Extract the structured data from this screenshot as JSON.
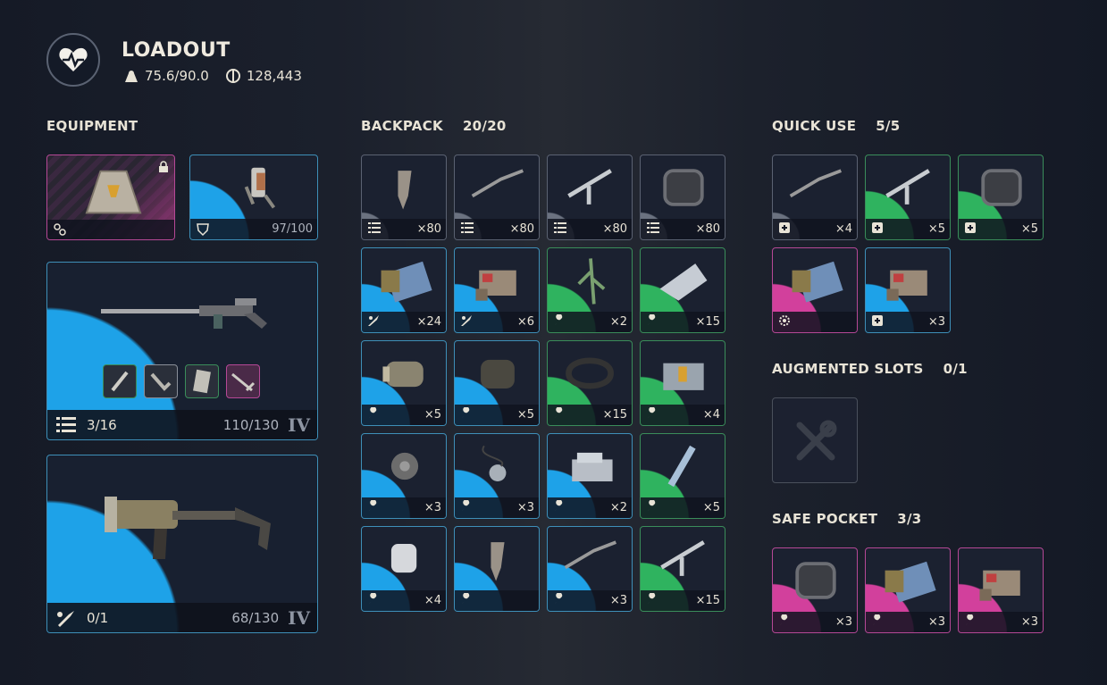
{
  "header": {
    "title": "LOADOUT",
    "weight": "75.6/90.0",
    "currency": "128,443"
  },
  "equipment": {
    "label": "EQUIPMENT",
    "augment": {
      "name": "augment-slot"
    },
    "shield": {
      "durability": "97/100"
    },
    "weapon1": {
      "ammo": "3/16",
      "durability": "110/130",
      "tier": "IV"
    },
    "weapon2": {
      "ammo": "0/1",
      "durability": "68/130",
      "tier": "IV"
    }
  },
  "backpack": {
    "label": "BACKPACK",
    "count": "20/20",
    "items": [
      {
        "icon": "ammo-icon",
        "qty": "×80",
        "rarity": "gray"
      },
      {
        "icon": "ammo-icon",
        "qty": "×80",
        "rarity": "gray"
      },
      {
        "icon": "ammo-icon",
        "qty": "×80",
        "rarity": "gray"
      },
      {
        "icon": "ammo-icon",
        "qty": "×80",
        "rarity": "gray"
      },
      {
        "icon": "rocket-icon",
        "qty": "×24",
        "rarity": "blue"
      },
      {
        "icon": "rocket-icon",
        "qty": "×6",
        "rarity": "blue"
      },
      {
        "icon": "wrench-icon",
        "qty": "×2",
        "rarity": "green"
      },
      {
        "icon": "wrench-icon",
        "qty": "×15",
        "rarity": "green"
      },
      {
        "icon": "wrench-icon",
        "qty": "×5",
        "rarity": "blue"
      },
      {
        "icon": "wrench-icon",
        "qty": "×5",
        "rarity": "blue"
      },
      {
        "icon": "wrench-icon",
        "qty": "×15",
        "rarity": "green"
      },
      {
        "icon": "wrench-icon",
        "qty": "×4",
        "rarity": "green"
      },
      {
        "icon": "wrench-icon",
        "qty": "×3",
        "rarity": "blue"
      },
      {
        "icon": "wrench-icon",
        "qty": "×3",
        "rarity": "blue"
      },
      {
        "icon": "wrench-icon",
        "qty": "×2",
        "rarity": "blue"
      },
      {
        "icon": "wrench-icon",
        "qty": "×5",
        "rarity": "green"
      },
      {
        "icon": "wrench-icon",
        "qty": "×4",
        "rarity": "blue"
      },
      {
        "icon": "wrench-icon",
        "qty": "",
        "rarity": "blue"
      },
      {
        "icon": "wrench-icon",
        "qty": "×3",
        "rarity": "blue"
      },
      {
        "icon": "wrench-icon",
        "qty": "×15",
        "rarity": "green"
      }
    ]
  },
  "quick_use": {
    "label": "QUICK USE",
    "count": "5/5",
    "items": [
      {
        "icon": "plus-icon",
        "qty": "×4",
        "rarity": "gray"
      },
      {
        "icon": "plus-icon",
        "qty": "×5",
        "rarity": "green"
      },
      {
        "icon": "plus-icon",
        "qty": "×5",
        "rarity": "green"
      },
      {
        "icon": "gear-icon",
        "qty": "",
        "rarity": "pink"
      },
      {
        "icon": "plus-icon",
        "qty": "×3",
        "rarity": "blue"
      }
    ]
  },
  "augmented": {
    "label": "AUGMENTED SLOTS",
    "count": "0/1"
  },
  "safe_pocket": {
    "label": "SAFE POCKET",
    "count": "3/3",
    "items": [
      {
        "icon": "wrench-icon",
        "qty": "×3",
        "rarity": "pink"
      },
      {
        "icon": "wrench-icon",
        "qty": "×3",
        "rarity": "pink"
      },
      {
        "icon": "wrench-icon",
        "qty": "×3",
        "rarity": "pink"
      }
    ]
  },
  "colors": {
    "blue": "#1ea2e8",
    "green": "#2fb35f",
    "pink": "#d2409c",
    "gray": "#6b7280"
  }
}
